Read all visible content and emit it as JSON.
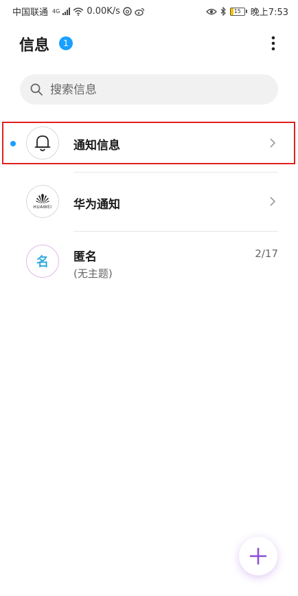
{
  "status_bar": {
    "carrier": "中国联通",
    "network_badge": "4G",
    "speed": "0.00K/s",
    "battery_level": "15",
    "time": "晚上7:53"
  },
  "header": {
    "title": "信息",
    "unread_count": "1"
  },
  "search": {
    "placeholder": "搜索信息"
  },
  "conversations": [
    {
      "title": "通知信息",
      "unread": true,
      "avatar_icon": "bell-icon"
    },
    {
      "title": "华为通知",
      "unread": false,
      "avatar_icon": "huawei-logo-icon",
      "avatar_text": "HUAWEI"
    },
    {
      "title": "匿名",
      "subtitle": "(无主题)",
      "date": "2/17",
      "avatar_text": "名"
    }
  ],
  "colors": {
    "accent": "#1aa0ff",
    "highlight": "#e0201c",
    "fab_plus": "#8a4fd8"
  }
}
